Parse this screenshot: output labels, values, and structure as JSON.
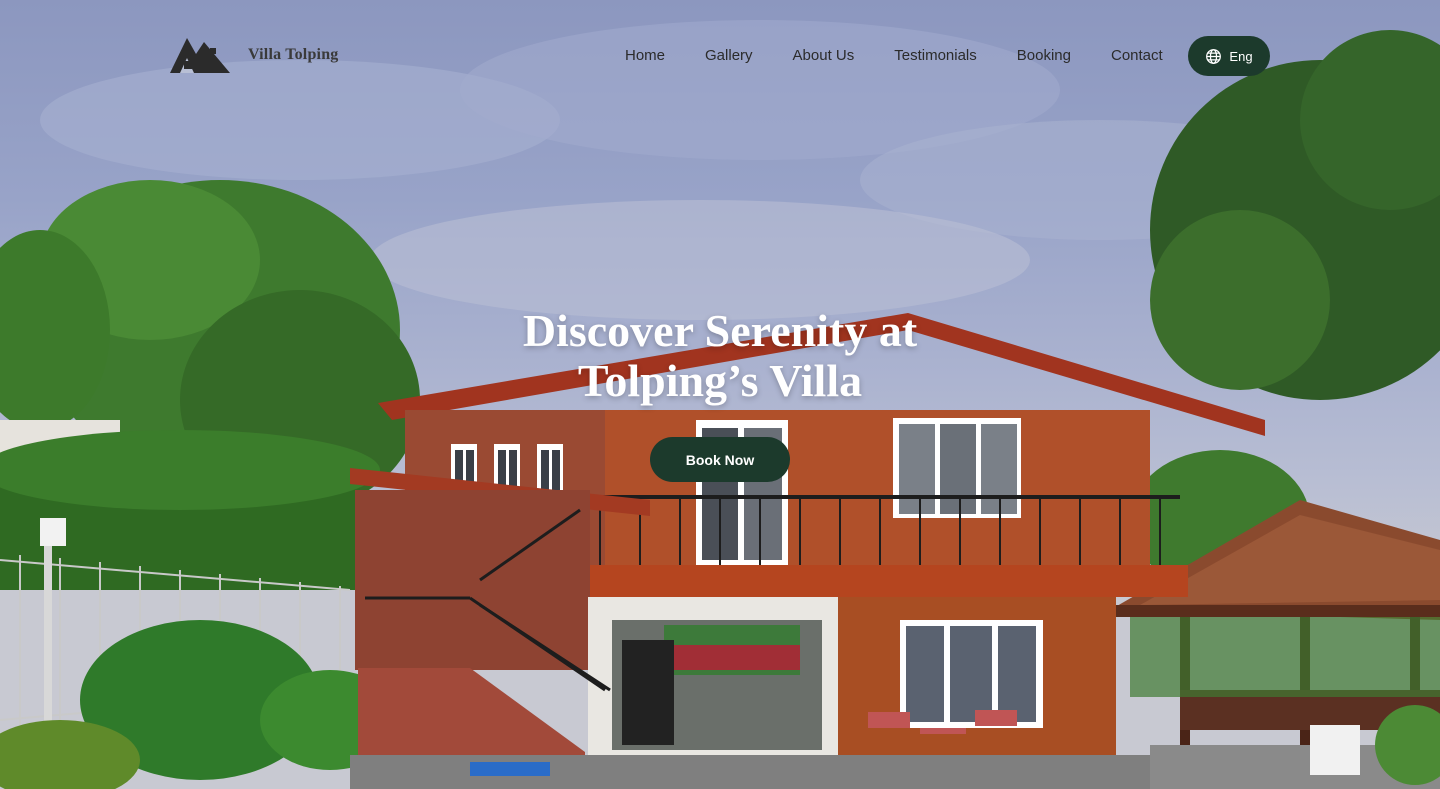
{
  "brand": {
    "name": "Villa Tolping",
    "logo_icon": "house-mountain-logo"
  },
  "nav": {
    "items": [
      {
        "label": "Home"
      },
      {
        "label": "Gallery"
      },
      {
        "label": "About Us"
      },
      {
        "label": "Testimonials"
      },
      {
        "label": "Booking"
      },
      {
        "label": "Contact"
      }
    ]
  },
  "language": {
    "label": "Eng",
    "icon": "globe-icon"
  },
  "hero": {
    "title_line1": "Discover Serenity at",
    "title_line2": "Tolping’s Villa",
    "cta_label": "Book Now"
  },
  "colors": {
    "accent": "#1c3a2c",
    "hero_text": "#ffffff",
    "nav_text": "#2b2b2b"
  }
}
